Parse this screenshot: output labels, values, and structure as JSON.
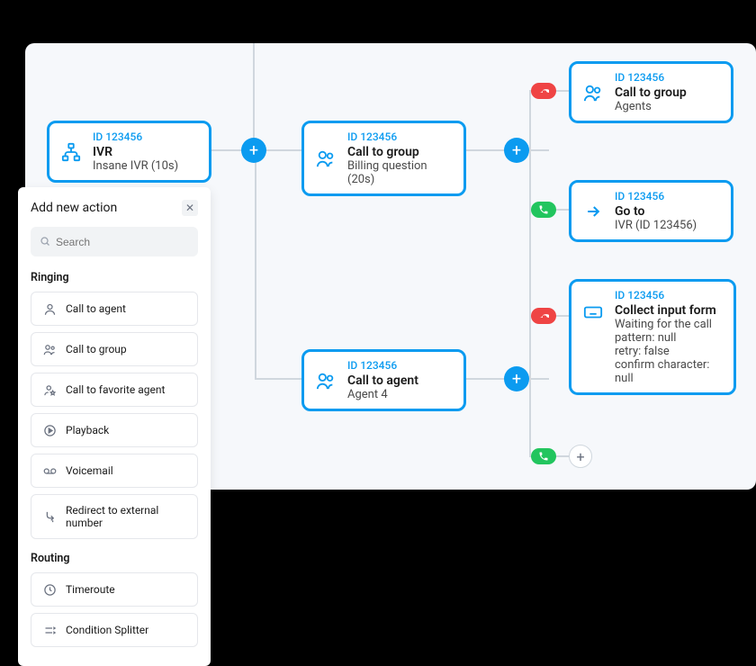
{
  "panel": {
    "title": "Add new action",
    "search_placeholder": "Search",
    "sections": {
      "ringing": {
        "title": "Ringing",
        "items": [
          {
            "label": "Call to agent"
          },
          {
            "label": "Call to group"
          },
          {
            "label": "Call to favorite agent"
          },
          {
            "label": "Playback"
          },
          {
            "label": "Voicemail"
          },
          {
            "label": "Redirect to external number"
          }
        ]
      },
      "routing": {
        "title": "Routing",
        "items": [
          {
            "label": "Timeroute"
          },
          {
            "label": "Condition Splitter"
          }
        ]
      }
    }
  },
  "nodes": {
    "ivr": {
      "id": "ID 123456",
      "title": "IVR",
      "sub": "Insane IVR (10s)"
    },
    "billing": {
      "id": "ID 123456",
      "title": "Call to group",
      "sub": "Billing question (20s)"
    },
    "agents": {
      "id": "ID 123456",
      "title": "Call to group",
      "sub": "Agents"
    },
    "goto": {
      "id": "ID 123456",
      "title": "Go to",
      "sub": "IVR (ID 123456)"
    },
    "agent4": {
      "id": "ID 123456",
      "title": "Call to agent",
      "sub": "Agent 4"
    },
    "collect": {
      "id": "ID 123456",
      "title": "Collect input form",
      "line1": "Waiting for the call",
      "line2": "pattern: null",
      "line3": "retry: false",
      "line4": "confirm character: null"
    }
  }
}
